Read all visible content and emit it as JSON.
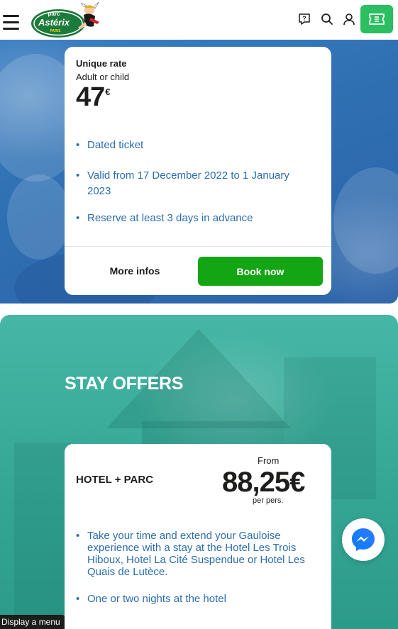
{
  "header": {
    "logo_top": "parc",
    "logo_main": "Astérix",
    "logo_sub": "PARIS",
    "icons": [
      "menu-icon",
      "help-icon",
      "search-icon",
      "user-icon",
      "ticket-icon"
    ],
    "accent": "#2bbf62"
  },
  "ticket_card": {
    "rate_label": "Unique rate",
    "rate_sub": "Adult or child",
    "price": "47",
    "currency": "€",
    "bullets": [
      "Dated ticket",
      "Valid from 17 December 2022 to 1 January 2023",
      "Reserve at least 3 days in advance"
    ],
    "more_label": "More infos",
    "book_label": "Book now"
  },
  "stay": {
    "title": "STAY OFFERS",
    "offer_name": "HOTEL + PARC",
    "from_label": "From",
    "price": "88,25€",
    "per_pers": "per pers.",
    "bullets": [
      "Take your time and extend your Gauloise experience with a stay at the Hotel Les Trois Hiboux, Hotel La Cité Suspendue or Hotel Les Quais de Lutèce.",
      "One or two nights at the hotel"
    ]
  },
  "footer": {
    "menu_label": "Display a menu"
  },
  "colors": {
    "hero_blue": "#2e6fb2",
    "stay_teal": "#35a594",
    "book_green": "#14a514",
    "bullet_blue": "#2b6db0"
  }
}
